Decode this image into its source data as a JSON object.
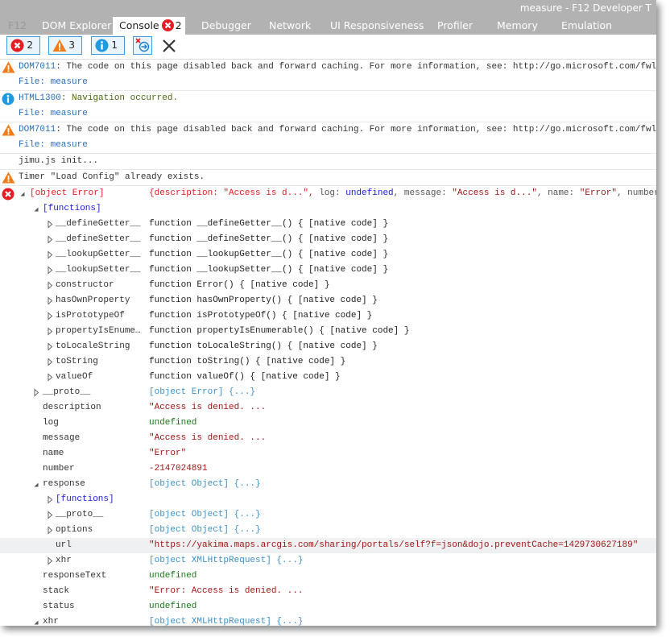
{
  "window_title": "measure - F12 Developer T",
  "tabs": [
    {
      "label": "F12"
    },
    {
      "label": "DOM Explorer"
    },
    {
      "label": "Console",
      "error_count": "2",
      "active": true
    },
    {
      "label": "Debugger"
    },
    {
      "label": "Network"
    },
    {
      "label": "UI Responsiveness"
    },
    {
      "label": "Profiler"
    },
    {
      "label": "Memory"
    },
    {
      "label": "Emulation"
    }
  ],
  "toolbar": {
    "errors": "2",
    "warnings": "3",
    "info": "1"
  },
  "colors": {
    "error": "#e51c23",
    "warning": "#f07d1a",
    "info": "#1e9be0",
    "tab_bar": "#b2b2b2",
    "accent": "#3c9be8"
  },
  "messages": [
    {
      "type": "warning",
      "code": "DOM7011",
      "text": ": The code on this page disabled back and forward caching. For more information, see: http://go.microsoft.com/fwl",
      "file": "File: measure"
    },
    {
      "type": "info",
      "code": "HTML1300",
      "text": ": Navigation occurred.",
      "file": "File: measure"
    },
    {
      "type": "warning",
      "code": "DOM7011",
      "text": ": The code on this page disabled back and forward caching. For more information, see: http://go.microsoft.com/fwl",
      "file": "File: measure"
    },
    {
      "type": "log",
      "text": "jimu.js init..."
    },
    {
      "type": "warning",
      "text": "Timer \"Load Config\" already exists."
    }
  ],
  "error_object": {
    "label": "[object Error]",
    "summary": [
      {
        "t": "{description: \"Access is d...\", ",
        "c": "v-err"
      },
      {
        "t": "log: ",
        "c": "v-key"
      },
      {
        "t": "undefined",
        "c": "v-fns"
      },
      {
        "t": ", message: ",
        "c": "v-key"
      },
      {
        "t": "\"Access is d...\"",
        "c": "v-str"
      },
      {
        "t": ", name: ",
        "c": "v-key"
      },
      {
        "t": "\"Error\"",
        "c": "v-str"
      },
      {
        "t": ", number",
        "c": "v-key"
      }
    ]
  },
  "tree": [
    {
      "level": 1,
      "toggle": "open",
      "name": "[functions]",
      "kind": "fns"
    },
    {
      "level": 2,
      "toggle": "closed",
      "name": "__defineGetter__",
      "value": "function __defineGetter__() { [native code] }",
      "kind": "fn"
    },
    {
      "level": 2,
      "toggle": "closed",
      "name": "__defineSetter__",
      "value": "function __defineSetter__() { [native code] }",
      "kind": "fn"
    },
    {
      "level": 2,
      "toggle": "closed",
      "name": "__lookupGetter__",
      "value": "function __lookupGetter__() { [native code] }",
      "kind": "fn"
    },
    {
      "level": 2,
      "toggle": "closed",
      "name": "__lookupSetter__",
      "value": "function __lookupSetter__() { [native code] }",
      "kind": "fn"
    },
    {
      "level": 2,
      "toggle": "closed",
      "name": "constructor",
      "value": "function Error() { [native code] }",
      "kind": "fn"
    },
    {
      "level": 2,
      "toggle": "closed",
      "name": "hasOwnProperty",
      "value": "function hasOwnProperty() { [native code] }",
      "kind": "fn"
    },
    {
      "level": 2,
      "toggle": "closed",
      "name": "isPrototypeOf",
      "value": "function isPrototypeOf() { [native code] }",
      "kind": "fn"
    },
    {
      "level": 2,
      "toggle": "closed",
      "name": "propertyIsEnume…",
      "value": "function propertyIsEnumerable() { [native code] }",
      "kind": "fn"
    },
    {
      "level": 2,
      "toggle": "closed",
      "name": "toLocaleString",
      "value": "function toLocaleString() { [native code] }",
      "kind": "fn"
    },
    {
      "level": 2,
      "toggle": "closed",
      "name": "toString",
      "value": "function toString() { [native code] }",
      "kind": "fn"
    },
    {
      "level": 2,
      "toggle": "closed",
      "name": "valueOf",
      "value": "function valueOf() { [native code] }",
      "kind": "fn"
    },
    {
      "level": 1,
      "toggle": "closed",
      "name": "__proto__",
      "value": "[object Error] {...}",
      "kind": "obj"
    },
    {
      "level": 1,
      "name": "description",
      "value": "\"Access is denied. ...",
      "kind": "str"
    },
    {
      "level": 1,
      "name": "log",
      "value": "undefined",
      "kind": "undef"
    },
    {
      "level": 1,
      "name": "message",
      "value": "\"Access is denied. ...",
      "kind": "str"
    },
    {
      "level": 1,
      "name": "name",
      "value": "\"Error\"",
      "kind": "str"
    },
    {
      "level": 1,
      "name": "number",
      "value": "-2147024891",
      "kind": "str"
    },
    {
      "level": 1,
      "toggle": "open",
      "name": "response",
      "value": "[object Object] {...}",
      "kind": "obj"
    },
    {
      "level": 2,
      "toggle": "closed",
      "name": "[functions]",
      "kind": "fns"
    },
    {
      "level": 2,
      "toggle": "closed",
      "name": "__proto__",
      "value": "[object Object] {...}",
      "kind": "obj"
    },
    {
      "level": 2,
      "toggle": "closed",
      "name": "options",
      "value": "[object Object] {...}",
      "kind": "obj"
    },
    {
      "level": 2,
      "name": "url",
      "value": "\"https://yakima.maps.arcgis.com/sharing/portals/self?f=json&dojo.preventCache=1429730627189\"",
      "kind": "str",
      "highlighted": true
    },
    {
      "level": 2,
      "toggle": "closed",
      "name": "xhr",
      "value": "[object XMLHttpRequest] {...}",
      "kind": "obj"
    },
    {
      "level": 1,
      "name": "responseText",
      "value": "undefined",
      "kind": "undef"
    },
    {
      "level": 1,
      "name": "stack",
      "value": "\"Error: Access is denied. ...",
      "kind": "str"
    },
    {
      "level": 1,
      "name": "status",
      "value": "undefined",
      "kind": "undef"
    },
    {
      "level": 1,
      "toggle": "open",
      "name": "xhr",
      "value": "[object XMLHttpRequest] {...}",
      "kind": "obj"
    }
  ]
}
